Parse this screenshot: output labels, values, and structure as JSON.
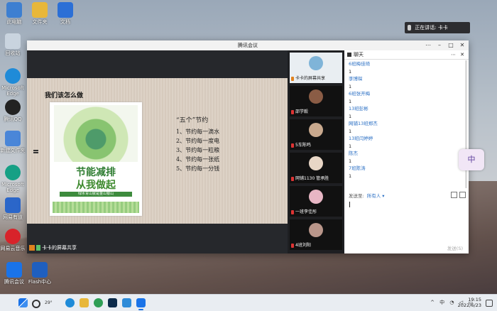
{
  "desktop": {
    "icons_top": [
      {
        "label": "此电脑",
        "color": "#3d7fd1"
      },
      {
        "label": "文件夹",
        "color": "#e8b73a"
      },
      {
        "label": "文档",
        "color": "#2b6fd6"
      }
    ],
    "icons_left": [
      {
        "label": "回收站",
        "color": "#c9d4df"
      },
      {
        "label": "Microsoft Edge",
        "color": "#1f8bd8"
      },
      {
        "label": "腾讯QQ",
        "color": "#222222"
      },
      {
        "label": "新建文件夹",
        "color": "#4a86d8"
      },
      {
        "label": "Microsoft Edge",
        "color": "#16a085"
      },
      {
        "label": "网易有道",
        "color": "#2b66c9"
      },
      {
        "label": "网易云音乐",
        "color": "#d8232a"
      }
    ],
    "icons_bottom": [
      {
        "label": "腾讯会议",
        "color": "#1a73e8"
      },
      {
        "label": "Flash中心",
        "color": "#1f5fbf"
      }
    ]
  },
  "notification": {
    "text": "正在讲话: 卡卡"
  },
  "meeting": {
    "window_title": "腾讯会议",
    "slide": {
      "title": "我们该怎么做",
      "poster_line1": "节能减排",
      "poster_line2": "从我做起",
      "poster_small": "绿水青山就是金山银山",
      "five_heading": "“五个”节约",
      "five_items": [
        "1、节约每一滴水",
        "2、节约每一度电",
        "3、节约每一粒粮",
        "4、节约每一张纸",
        "5、节约每一分钱"
      ]
    },
    "sharer_label": "卡卡的屏幕共享",
    "participants": [
      {
        "label": "卡卡的屏幕共享",
        "active": true
      },
      {
        "label": "邵学毅",
        "active": false
      },
      {
        "label": "5车陈鸣",
        "active": false
      },
      {
        "label": "网铺1130  管承胜",
        "active": false
      },
      {
        "label": "一班李佳彤",
        "active": false
      },
      {
        "label": "4班刘阳",
        "active": false
      }
    ]
  },
  "chat": {
    "title": "聊天",
    "messages": [
      {
        "name": "6班梅佳琦",
        "msg": "1"
      },
      {
        "name": "李博琛",
        "msg": "1"
      },
      {
        "name": "6班张开梅",
        "msg": "1"
      },
      {
        "name": "13班彭彬",
        "msg": "1"
      },
      {
        "name": "网铺13班郑杰",
        "msg": "1"
      },
      {
        "name": "13班闫婷婷",
        "msg": "1"
      },
      {
        "name": "陈杰",
        "msg": "1"
      },
      {
        "name": "7班陈涛",
        "msg": "1"
      }
    ],
    "send_to_label": "发送至:",
    "send_to_value": "所有人 ▾",
    "send_button": "发送(S)"
  },
  "ime": {
    "label": "中"
  },
  "taskbar": {
    "weather": "29°",
    "clock_time": "19:15",
    "clock_date": "2022/6/23",
    "tray_lang": "中"
  }
}
